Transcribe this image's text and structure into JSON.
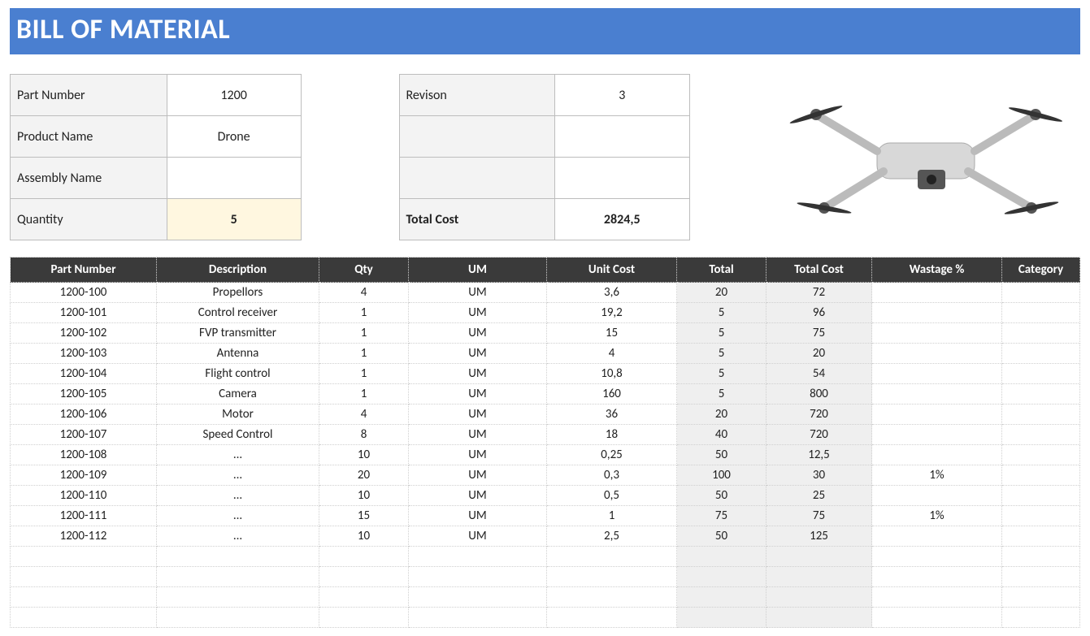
{
  "title": "BILL OF MATERIAL",
  "meta_left": [
    {
      "label": "Part Number",
      "value": "1200"
    },
    {
      "label": "Product Name",
      "value": "Drone"
    },
    {
      "label": "Assembly Name",
      "value": ""
    },
    {
      "label": "Quantity",
      "value": "5",
      "highlight": true
    }
  ],
  "meta_right": [
    {
      "label": "Revison",
      "value": "3"
    },
    {
      "label": "",
      "value": ""
    },
    {
      "label": "",
      "value": ""
    },
    {
      "label": "Total Cost",
      "value": "2824,5",
      "bold": true
    }
  ],
  "headers": [
    "Part Number",
    "Description",
    "Qty",
    "UM",
    "Unit Cost",
    "Total",
    "Total Cost",
    "Wastage %",
    "Category"
  ],
  "rows": [
    {
      "pn": "1200-100",
      "desc": "Propellors",
      "qty": "4",
      "um": "UM",
      "uc": "3,6",
      "tot": "20",
      "tc": "72",
      "w": "",
      "cat": ""
    },
    {
      "pn": "1200-101",
      "desc": "Control receiver",
      "qty": "1",
      "um": "UM",
      "uc": "19,2",
      "tot": "5",
      "tc": "96",
      "w": "",
      "cat": ""
    },
    {
      "pn": "1200-102",
      "desc": "FVP transmitter",
      "qty": "1",
      "um": "UM",
      "uc": "15",
      "tot": "5",
      "tc": "75",
      "w": "",
      "cat": ""
    },
    {
      "pn": "1200-103",
      "desc": "Antenna",
      "qty": "1",
      "um": "UM",
      "uc": "4",
      "tot": "5",
      "tc": "20",
      "w": "",
      "cat": ""
    },
    {
      "pn": "1200-104",
      "desc": "Flight control",
      "qty": "1",
      "um": "UM",
      "uc": "10,8",
      "tot": "5",
      "tc": "54",
      "w": "",
      "cat": ""
    },
    {
      "pn": "1200-105",
      "desc": "Camera",
      "qty": "1",
      "um": "UM",
      "uc": "160",
      "tot": "5",
      "tc": "800",
      "w": "",
      "cat": ""
    },
    {
      "pn": "1200-106",
      "desc": "Motor",
      "qty": "4",
      "um": "UM",
      "uc": "36",
      "tot": "20",
      "tc": "720",
      "w": "",
      "cat": ""
    },
    {
      "pn": "1200-107",
      "desc": "Speed Control",
      "qty": "8",
      "um": "UM",
      "uc": "18",
      "tot": "40",
      "tc": "720",
      "w": "",
      "cat": ""
    },
    {
      "pn": "1200-108",
      "desc": "...",
      "qty": "10",
      "um": "UM",
      "uc": "0,25",
      "tot": "50",
      "tc": "12,5",
      "w": "",
      "cat": ""
    },
    {
      "pn": "1200-109",
      "desc": "...",
      "qty": "20",
      "um": "UM",
      "uc": "0,3",
      "tot": "100",
      "tc": "30",
      "w": "1%",
      "cat": ""
    },
    {
      "pn": "1200-110",
      "desc": "...",
      "qty": "10",
      "um": "UM",
      "uc": "0,5",
      "tot": "50",
      "tc": "25",
      "w": "",
      "cat": ""
    },
    {
      "pn": "1200-111",
      "desc": "...",
      "qty": "15",
      "um": "UM",
      "uc": "1",
      "tot": "75",
      "tc": "75",
      "w": "1%",
      "cat": ""
    },
    {
      "pn": "1200-112",
      "desc": "...",
      "qty": "10",
      "um": "UM",
      "uc": "2,5",
      "tot": "50",
      "tc": "125",
      "w": "",
      "cat": ""
    }
  ],
  "blank_rows": 4,
  "col_widths": [
    "180px",
    "200px",
    "110px",
    "170px",
    "160px",
    "110px",
    "130px",
    "160px",
    "auto"
  ]
}
